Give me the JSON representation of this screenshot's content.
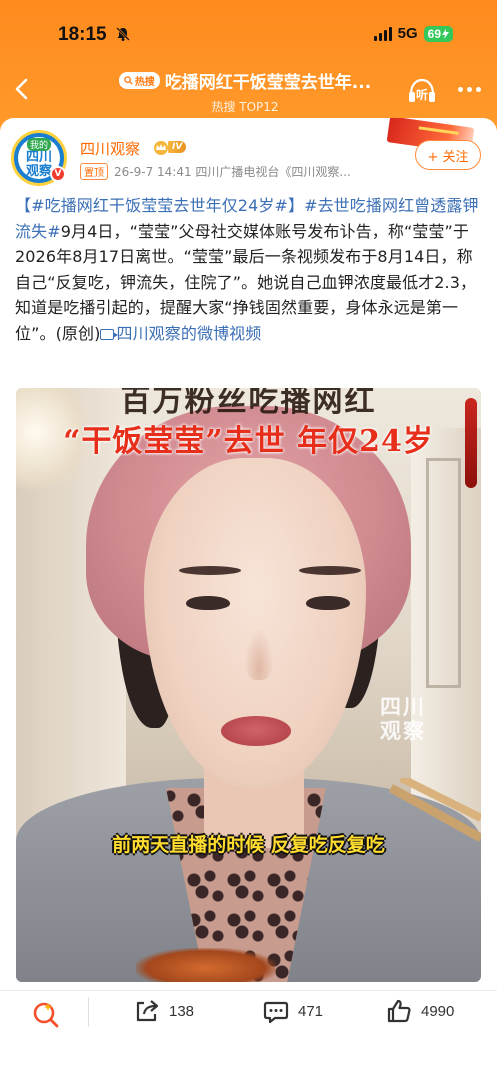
{
  "status_bar": {
    "time": "18:15",
    "network": "5G",
    "battery": "69"
  },
  "nav": {
    "hot_badge": "热搜",
    "title": "吃播网红干饭莹莹去世年...",
    "subtitle": "热搜 TOP12",
    "listen_label": "听"
  },
  "post": {
    "author": "四川观察",
    "vip_level": "IV",
    "pin_tag": "置顶",
    "meta": "26-9-7 14:41  四川广播电视台《四川观察...",
    "follow_label": "+ 关注",
    "avatar_top": "我的",
    "avatar_main_1": "四川",
    "avatar_main_2": "观察",
    "avatar_verified": "V",
    "text": {
      "tag1": "【#吃播网红干饭莹莹去世年仅24岁#】",
      "tag2": "#去世吃播网红曾透露钾流失#",
      "body": "9月4日，“莹莹”父母社交媒体账号发布讣告，称“莹莹”于2026年8月17日离世。“莹莹”最后一条视频发布于8月14日，称自己“反复吃，钾流失，住院了”。她说自己血钾浓度最低才2.3，知道是吃播引起的，提醒大家“挣钱固然重要，身体永远是第一位”。(原创)",
      "video_link": "四川观察的微博视频"
    }
  },
  "video": {
    "title_top": "百万粉丝吃播网红",
    "title": "“干饭莹莹”去世 年仅24岁",
    "watermark": "四川观察",
    "caption": "前两天直播的时候 反复吃反复吃"
  },
  "bottom_bar": {
    "shares": "138",
    "comments": "471",
    "likes": "4990"
  },
  "colors": {
    "accent": "#ff8a1e",
    "link": "#3b6fb6",
    "author": "#ff6a00"
  }
}
